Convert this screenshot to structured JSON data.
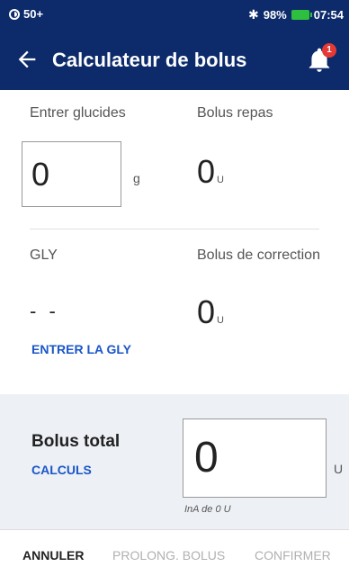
{
  "status_bar": {
    "notification_count": "50+",
    "battery": "98%",
    "time": "07:54",
    "colors": {
      "bar": "#0d2b6b",
      "battery": "#2fbf3f"
    }
  },
  "header": {
    "title": "Calculateur de bolus",
    "notification_badge": "1",
    "colors": {
      "bar": "#0d2b6b",
      "badge": "#e53935"
    }
  },
  "carbs": {
    "label": "Entrer glucides",
    "value": "0",
    "unit": "g"
  },
  "meal_bolus": {
    "label": "Bolus repas",
    "value": "0",
    "unit": "U"
  },
  "glucose": {
    "label": "GLY",
    "value": "- -",
    "action": "ENTRER LA GLY"
  },
  "correction_bolus": {
    "label": "Bolus de correction",
    "value": "0",
    "unit": "U"
  },
  "total": {
    "label": "Bolus total",
    "calc_link": "CALCULS",
    "value": "0",
    "unit": "U",
    "iob_text": "InA de 0 U"
  },
  "footer": {
    "cancel": "ANNULER",
    "extend": "PROLONG. BOLUS",
    "confirm": "CONFIRMER"
  },
  "icons": [
    "sim-icon",
    "bluetooth-icon",
    "battery-icon",
    "back-arrow-icon",
    "bell-icon"
  ],
  "accent_color": "#1a56c8"
}
